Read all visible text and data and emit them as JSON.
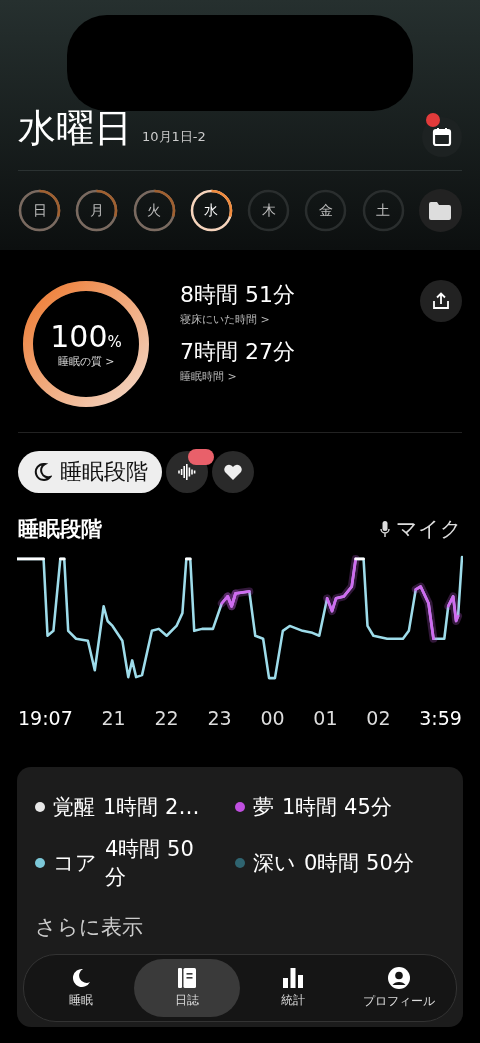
{
  "header": {
    "title": "水曜日",
    "date": "10月1日-2",
    "calendar_badge": true
  },
  "days": [
    {
      "label": "日",
      "recorded": true,
      "selected": false
    },
    {
      "label": "月",
      "recorded": true,
      "selected": false
    },
    {
      "label": "火",
      "recorded": true,
      "selected": false
    },
    {
      "label": "水",
      "recorded": true,
      "selected": true
    },
    {
      "label": "木",
      "recorded": false,
      "selected": false
    },
    {
      "label": "金",
      "recorded": false,
      "selected": false
    },
    {
      "label": "土",
      "recorded": false,
      "selected": false
    }
  ],
  "quality": {
    "value": "100",
    "unit": "%",
    "label": "睡眠の質 >"
  },
  "stats": [
    {
      "value": "8時間 51分",
      "label": "寝床にいた時間 >"
    },
    {
      "value": "7時間 27分",
      "label": "睡眠時間 >"
    }
  ],
  "chips": [
    {
      "kind": "stages",
      "label": "睡眠段階",
      "selected": true
    },
    {
      "kind": "sound",
      "selected": false,
      "badge": true
    },
    {
      "kind": "heart",
      "selected": false
    }
  ],
  "chart": {
    "title": "睡眠段階",
    "source": "マイク",
    "time_labels": [
      "19:07",
      "21",
      "22",
      "23",
      "00",
      "01",
      "02",
      "3:59"
    ]
  },
  "stages": [
    {
      "label": "覚醒",
      "value": "1時間 2…",
      "color": "#e8e8e8"
    },
    {
      "label": "夢",
      "value": "1時間 45分",
      "color": "#c04fe0"
    },
    {
      "label": "コア",
      "value": "4時間 50分",
      "color": "#7cc8d8"
    },
    {
      "label": "深い",
      "value": "0時間 50分",
      "color": "#2f6470"
    }
  ],
  "more": "さらに表示",
  "tabs": [
    {
      "kind": "moon",
      "label": "睡眠",
      "selected": false
    },
    {
      "kind": "journal",
      "label": "日誌",
      "selected": true
    },
    {
      "kind": "stats",
      "label": "統計",
      "selected": false
    },
    {
      "kind": "profile",
      "label": "プロフィール",
      "selected": false
    }
  ]
}
